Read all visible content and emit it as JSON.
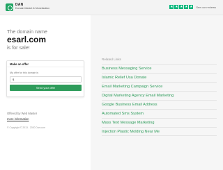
{
  "header": {
    "logo_name": "DAN",
    "logo_tagline": "Domain Market & Monetization",
    "trust_text": "See our reviews"
  },
  "hero": {
    "intro": "The domain name",
    "domain": "esarl.com",
    "for_sale": "is for sale!"
  },
  "offer": {
    "heading": "Make an offer",
    "label": "My offer for this domain is",
    "input_value": "$",
    "button": "Send your offer"
  },
  "footer": {
    "offered_by": "Offered by Web Master",
    "more_info": "more information",
    "copyright": "© Copyright © 2013 - 2020 Dan.com"
  },
  "related": {
    "title": "Related Links",
    "links": [
      "Business Messaging Service",
      "Islamic Relief Usa Donate",
      "Email Marketing Campaign Service",
      "Digital Marketing Agency Email Marketing",
      "Google Business Email Address",
      "Automated Sms System",
      "Mass Text Message Marketing",
      "Injection Plastic Molding Near Me"
    ]
  },
  "colors": {
    "accent": "#2e9c5b",
    "trustpilot": "#00b67a"
  }
}
